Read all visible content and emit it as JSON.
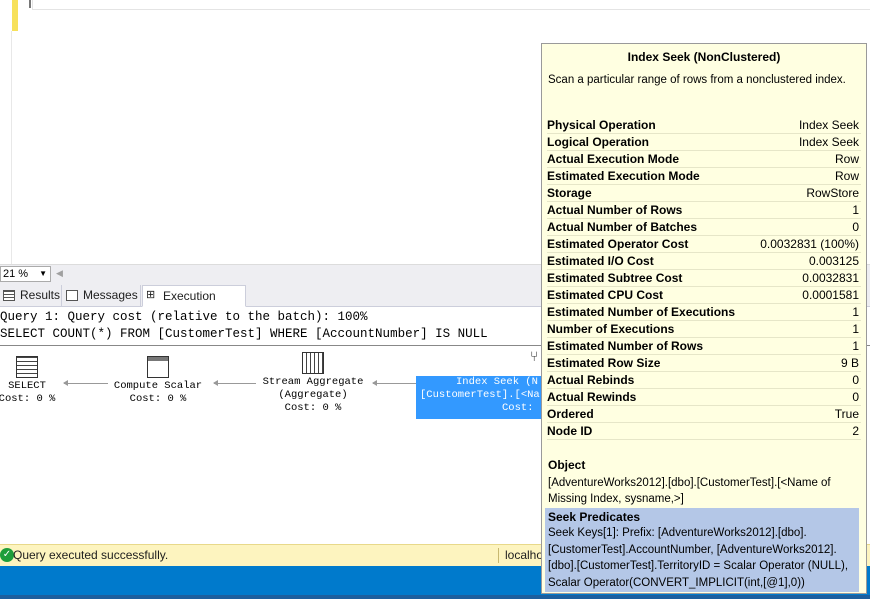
{
  "zoom": {
    "value": "21 %"
  },
  "tabs": [
    {
      "label": "Results"
    },
    {
      "label": "Messages"
    },
    {
      "label": "Execution plan"
    }
  ],
  "plan": {
    "query_header": "Query 1: Query cost (relative to the batch): 100%",
    "query_sql": "SELECT COUNT(*) FROM [CustomerTest] WHERE [AccountNumber] IS NULL",
    "nodes": {
      "select": {
        "name": "SELECT",
        "cost": "Cost: 0 %"
      },
      "compute": {
        "name": "Compute Scalar",
        "cost": "Cost: 0 %"
      },
      "stream": {
        "name": "Stream Aggregate",
        "sub": "(Aggregate)",
        "cost": "Cost: 0 %"
      },
      "seek": {
        "name": "Index Seek (N",
        "sub": "[CustomerTest].[<Na",
        "cost": "Cost:"
      }
    }
  },
  "tooltip": {
    "title": "Index Seek (NonClustered)",
    "description": "Scan a particular range of rows from a nonclustered index.",
    "rows": [
      {
        "k": "Physical Operation",
        "v": "Index Seek"
      },
      {
        "k": "Logical Operation",
        "v": "Index Seek"
      },
      {
        "k": "Actual Execution Mode",
        "v": "Row"
      },
      {
        "k": "Estimated Execution Mode",
        "v": "Row"
      },
      {
        "k": "Storage",
        "v": "RowStore"
      },
      {
        "k": "Actual Number of Rows",
        "v": "1"
      },
      {
        "k": "Actual Number of Batches",
        "v": "0"
      },
      {
        "k": "Estimated Operator Cost",
        "v": "0.0032831 (100%)"
      },
      {
        "k": "Estimated I/O Cost",
        "v": "0.003125"
      },
      {
        "k": "Estimated Subtree Cost",
        "v": "0.0032831"
      },
      {
        "k": "Estimated CPU Cost",
        "v": "0.0001581"
      },
      {
        "k": "Estimated Number of Executions",
        "v": "1"
      },
      {
        "k": "Number of Executions",
        "v": "1"
      },
      {
        "k": "Estimated Number of Rows",
        "v": "1"
      },
      {
        "k": "Estimated Row Size",
        "v": "9 B"
      },
      {
        "k": "Actual Rebinds",
        "v": "0"
      },
      {
        "k": "Actual Rewinds",
        "v": "0"
      },
      {
        "k": "Ordered",
        "v": "True"
      },
      {
        "k": "Node ID",
        "v": "2"
      }
    ],
    "object_title": "Object",
    "object_value": "[AdventureWorks2012].[dbo].[CustomerTest].[<Name of Missing Index, sysname,>]",
    "seek_title": "Seek Predicates",
    "seek_value": "Seek Keys[1]: Prefix: [AdventureWorks2012].[dbo].[CustomerTest].AccountNumber, [AdventureWorks2012].[dbo].[CustomerTest].TerritoryID = Scalar Operator (NULL), Scalar Operator(CONVERT_IMPLICIT(int,[@1],0))"
  },
  "status": {
    "message": "Query executed successfully.",
    "server": "localho"
  }
}
